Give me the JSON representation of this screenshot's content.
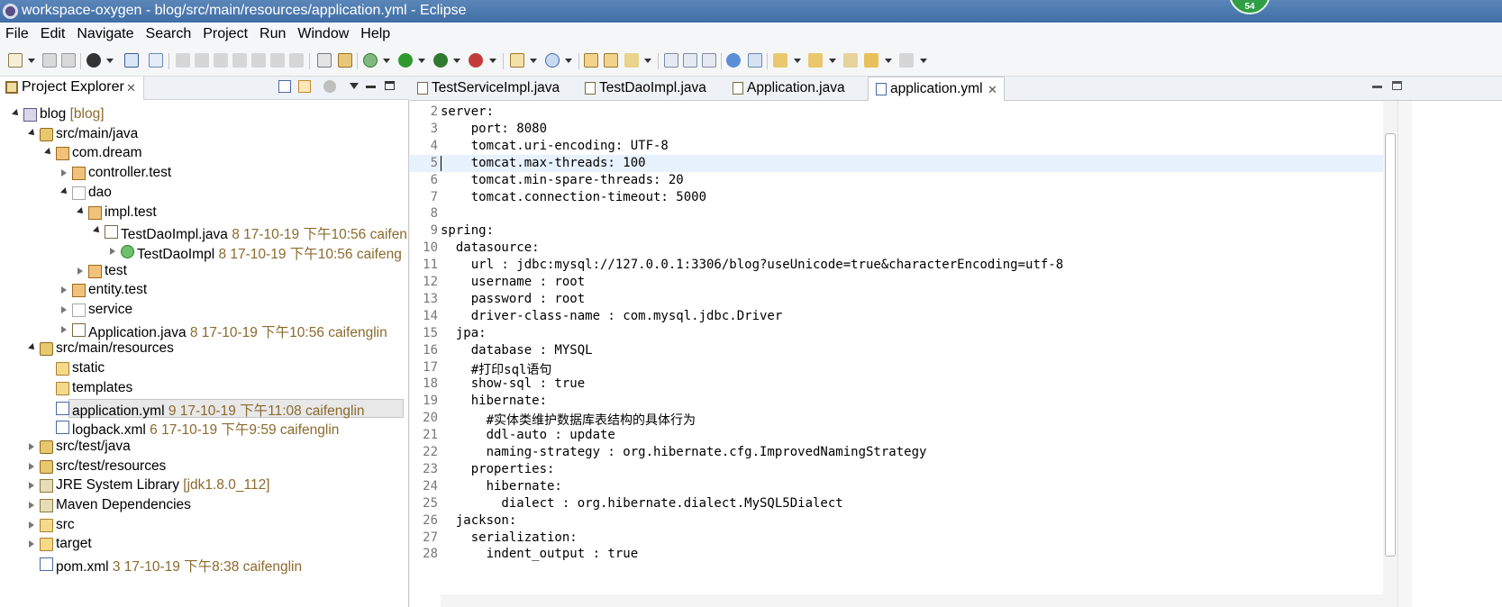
{
  "window": {
    "title": "workspace-oxygen - blog/src/main/resources/application.yml - Eclipse",
    "badge": "54"
  },
  "menu": [
    "File",
    "Edit",
    "Navigate",
    "Search",
    "Project",
    "Run",
    "Window",
    "Help"
  ],
  "project_explorer": {
    "tab_label": "Project Explorer",
    "tree": [
      {
        "label": "blog",
        "decoration": "[blog]",
        "depth": 0,
        "state": "expanded",
        "icon": "project-icon"
      },
      {
        "label": "src/main/java",
        "decoration": "",
        "depth": 1,
        "state": "expanded",
        "icon": "source-folder-icon"
      },
      {
        "label": "com.dream",
        "decoration": "",
        "depth": 2,
        "state": "expanded",
        "icon": "package-icon"
      },
      {
        "label": "controller.test",
        "decoration": "",
        "depth": 3,
        "state": "collapsed",
        "icon": "package-icon"
      },
      {
        "label": "dao",
        "decoration": "",
        "depth": 3,
        "state": "expanded",
        "icon": "empty-package-icon"
      },
      {
        "label": "impl.test",
        "decoration": "",
        "depth": 4,
        "state": "expanded",
        "icon": "package-icon"
      },
      {
        "label": "TestDaoImpl.java",
        "decoration": "8  17-10-19 下午10:56  caifen",
        "depth": 5,
        "state": "expanded",
        "icon": "java-file-icon"
      },
      {
        "label": "TestDaoImpl",
        "decoration": "8  17-10-19 下午10:56  caifeng",
        "depth": 6,
        "state": "collapsed",
        "icon": "class-icon"
      },
      {
        "label": "test",
        "decoration": "",
        "depth": 4,
        "state": "collapsed",
        "icon": "package-icon"
      },
      {
        "label": "entity.test",
        "decoration": "",
        "depth": 3,
        "state": "collapsed",
        "icon": "package-icon"
      },
      {
        "label": "service",
        "decoration": "",
        "depth": 3,
        "state": "collapsed",
        "icon": "empty-package-icon"
      },
      {
        "label": "Application.java",
        "decoration": "8  17-10-19 下午10:56  caifenglin",
        "depth": 3,
        "state": "collapsed",
        "icon": "java-file-icon"
      },
      {
        "label": "src/main/resources",
        "decoration": "",
        "depth": 1,
        "state": "expanded",
        "icon": "source-folder-icon"
      },
      {
        "label": "static",
        "decoration": "",
        "depth": 2,
        "state": "none",
        "icon": "folder-icon"
      },
      {
        "label": "templates",
        "decoration": "",
        "depth": 2,
        "state": "none",
        "icon": "folder-icon"
      },
      {
        "label": "application.yml",
        "decoration": "9  17-10-19 下午11:08  caifenglin",
        "depth": 2,
        "state": "none",
        "icon": "yml-file-icon",
        "selected": true
      },
      {
        "label": "logback.xml",
        "decoration": "6  17-10-19 下午9:59  caifenglin",
        "depth": 2,
        "state": "none",
        "icon": "xml-file-icon"
      },
      {
        "label": "src/test/java",
        "decoration": "",
        "depth": 1,
        "state": "collapsed",
        "icon": "source-folder-icon"
      },
      {
        "label": "src/test/resources",
        "decoration": "",
        "depth": 1,
        "state": "collapsed",
        "icon": "source-folder-icon"
      },
      {
        "label": "JRE System Library",
        "decoration": "[jdk1.8.0_112]",
        "depth": 1,
        "state": "collapsed",
        "icon": "library-icon"
      },
      {
        "label": "Maven Dependencies",
        "decoration": "",
        "depth": 1,
        "state": "collapsed",
        "icon": "library-icon"
      },
      {
        "label": "src",
        "decoration": "",
        "depth": 1,
        "state": "collapsed",
        "icon": "folder-icon"
      },
      {
        "label": "target",
        "decoration": "",
        "depth": 1,
        "state": "collapsed",
        "icon": "folder-icon"
      },
      {
        "label": "pom.xml",
        "decoration": "3  17-10-19 下午8:38  caifenglin",
        "depth": 1,
        "state": "none",
        "icon": "xml-file-icon"
      }
    ]
  },
  "editor": {
    "tabs": [
      {
        "label": "TestServiceImpl.java",
        "active": false
      },
      {
        "label": "TestDaoImpl.java",
        "active": false
      },
      {
        "label": "Application.java",
        "active": false
      },
      {
        "label": "application.yml",
        "active": true
      }
    ],
    "current_line": 5,
    "lines": [
      {
        "n": "2",
        "text": "server:"
      },
      {
        "n": "3",
        "text": "    port: 8080"
      },
      {
        "n": "4",
        "text": "    tomcat.uri-encoding: UTF-8"
      },
      {
        "n": "5",
        "text": "    tomcat.max-threads: 100"
      },
      {
        "n": "6",
        "text": "    tomcat.min-spare-threads: 20"
      },
      {
        "n": "7",
        "text": "    tomcat.connection-timeout: 5000"
      },
      {
        "n": "8",
        "text": ""
      },
      {
        "n": "9",
        "text": "spring:"
      },
      {
        "n": "10",
        "text": "  datasource:"
      },
      {
        "n": "11",
        "text": "    url : jdbc:mysql://127.0.0.1:3306/blog?useUnicode=true&characterEncoding=utf-8"
      },
      {
        "n": "12",
        "text": "    username : root"
      },
      {
        "n": "13",
        "text": "    password : root"
      },
      {
        "n": "14",
        "text": "    driver-class-name : com.mysql.jdbc.Driver"
      },
      {
        "n": "15",
        "text": "  jpa:"
      },
      {
        "n": "16",
        "text": "    database : MYSQL"
      },
      {
        "n": "17",
        "text": "    #打印sql语句"
      },
      {
        "n": "18",
        "text": "    show-sql : true"
      },
      {
        "n": "19",
        "text": "    hibernate:"
      },
      {
        "n": "20",
        "text": "      #实体类维护数据库表结构的具体行为"
      },
      {
        "n": "21",
        "text": "      ddl-auto : update"
      },
      {
        "n": "22",
        "text": "      naming-strategy : org.hibernate.cfg.ImprovedNamingStrategy"
      },
      {
        "n": "23",
        "text": "    properties:"
      },
      {
        "n": "24",
        "text": "      hibernate:"
      },
      {
        "n": "25",
        "text": "        dialect : org.hibernate.dialect.MySQL5Dialect"
      },
      {
        "n": "26",
        "text": "  jackson:"
      },
      {
        "n": "27",
        "text": "    serialization:"
      },
      {
        "n": "28",
        "text": "      indent_output : true"
      }
    ]
  }
}
